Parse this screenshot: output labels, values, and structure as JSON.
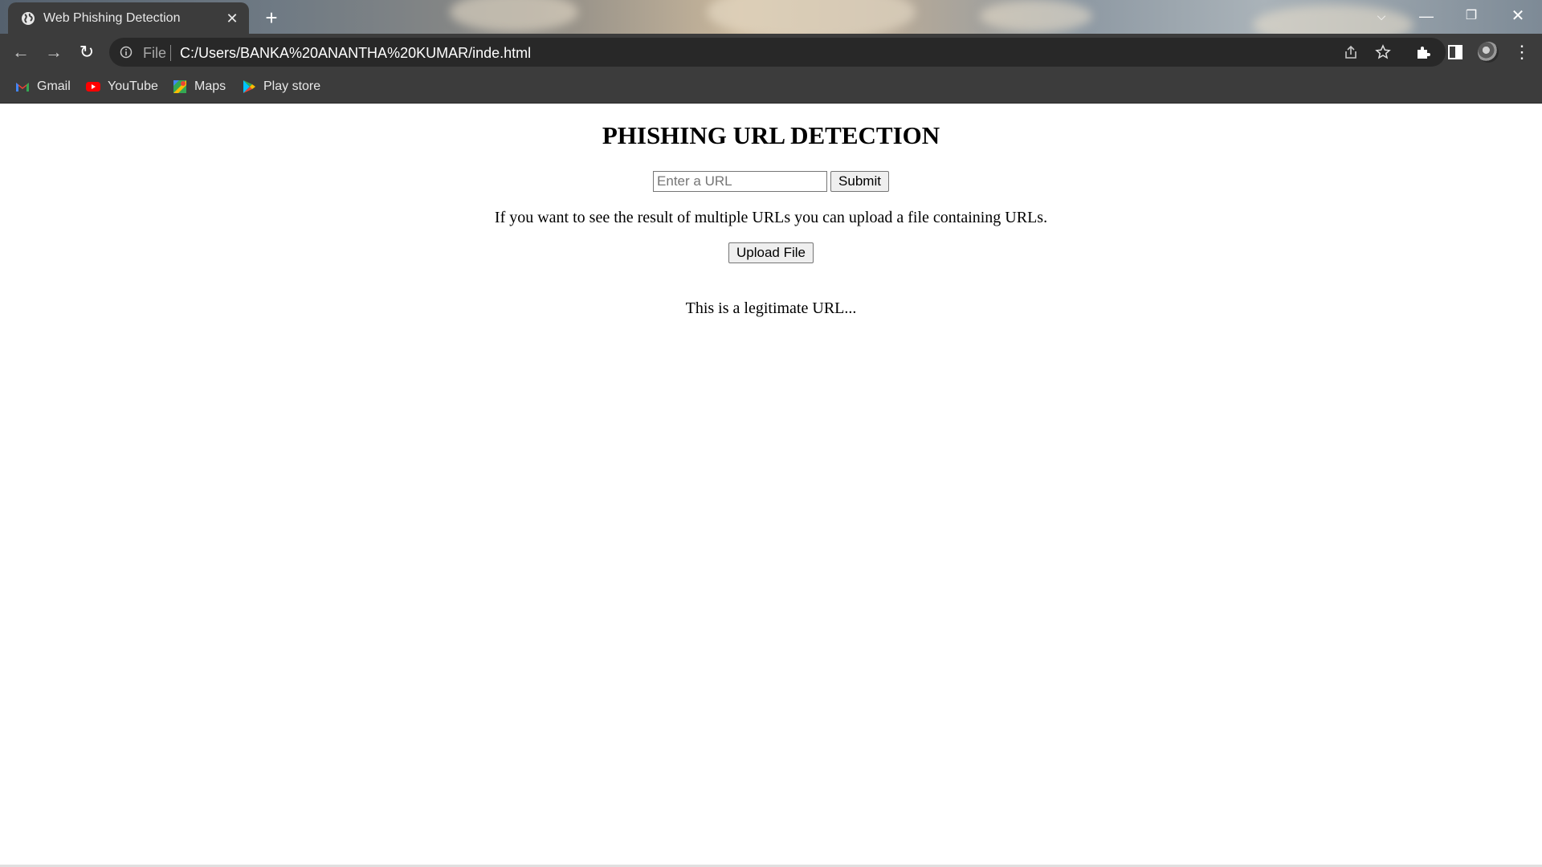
{
  "browser": {
    "tab_title": "Web Phishing Detection",
    "address_scheme": "File",
    "address_url": "C:/Users/BANKA%20ANANTHA%20KUMAR/inde.html",
    "bookmarks": [
      {
        "label": "Gmail",
        "icon": "gmail-icon"
      },
      {
        "label": "YouTube",
        "icon": "youtube-icon"
      },
      {
        "label": "Maps",
        "icon": "maps-icon"
      },
      {
        "label": "Play store",
        "icon": "play-store-icon"
      }
    ],
    "colors": {
      "chrome_bg": "#3c3c3c",
      "omnibox_bg": "#282828"
    }
  },
  "page": {
    "title": "PHISHING URL DETECTION",
    "url_input": {
      "placeholder": "Enter a URL",
      "value": ""
    },
    "submit_label": "Submit",
    "info_text": "If you want to see the result of multiple URLs you can upload a file containing URLs.",
    "upload_label": "Upload File",
    "result_text": "This is a legitimate URL..."
  }
}
